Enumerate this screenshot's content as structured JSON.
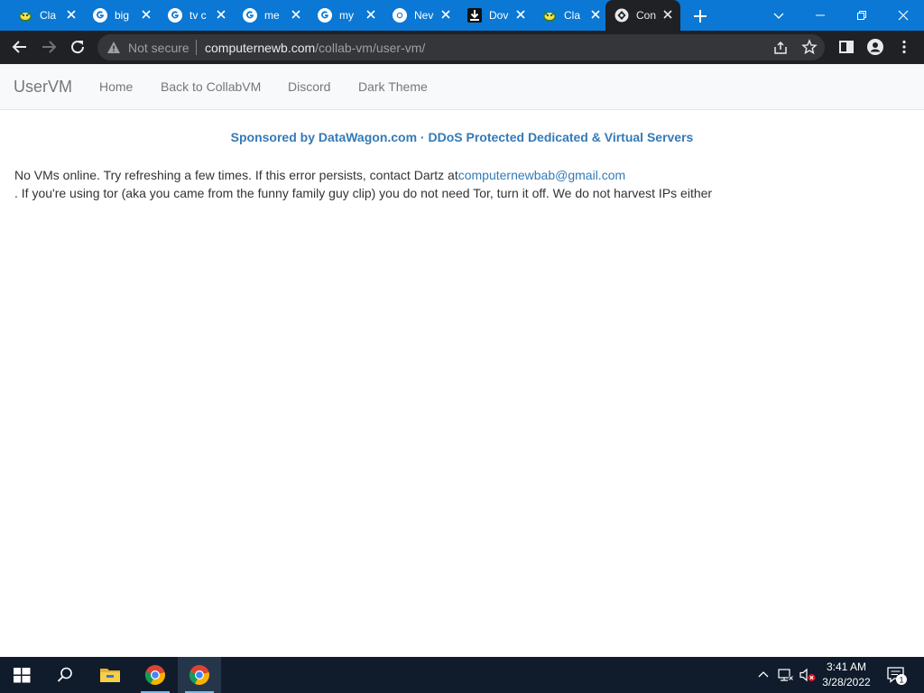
{
  "browser": {
    "tabs": [
      {
        "title": "Cla",
        "icon": "clash-monster-icon"
      },
      {
        "title": "big",
        "icon": "google-icon"
      },
      {
        "title": "tv c",
        "icon": "google-icon"
      },
      {
        "title": "me",
        "icon": "google-icon"
      },
      {
        "title": "my",
        "icon": "google-icon"
      },
      {
        "title": "Nev",
        "icon": "chrome-icon"
      },
      {
        "title": "Dov",
        "icon": "download-icon"
      },
      {
        "title": "Cla",
        "icon": "clash-monster-icon"
      },
      {
        "title": "Con",
        "icon": "collabvm-icon",
        "active": true
      }
    ],
    "security_label": "Not secure",
    "url_host": "computernewb.com",
    "url_path": "/collab-vm/user-vm/"
  },
  "page": {
    "navbar": {
      "brand": "UserVM",
      "links": [
        "Home",
        "Back to CollabVM",
        "Discord",
        "Dark Theme"
      ]
    },
    "sponsor": "Sponsored by DataWagon.com · DDoS Protected Dedicated & Virtual Servers",
    "message": {
      "text_before": "No VMs online. Try refreshing a few times. If this error persists, contact Dartz at",
      "email": "computernewbab@gmail.com",
      "text_after": ". If you're using tor (aka you came from the funny family guy clip) you do not need Tor, turn it off. We do not harvest IPs either"
    }
  },
  "taskbar": {
    "apps": [
      "start-icon",
      "search-icon",
      "file-explorer-icon",
      "chrome-icon",
      "chrome-icon"
    ],
    "time": "3:41 AM",
    "date": "3/28/2022",
    "notification_count": "1"
  },
  "colors": {
    "tabstrip": "#0a78d4",
    "toolbar": "#202124",
    "link": "#337ab7",
    "taskbar": "#101c2c"
  }
}
